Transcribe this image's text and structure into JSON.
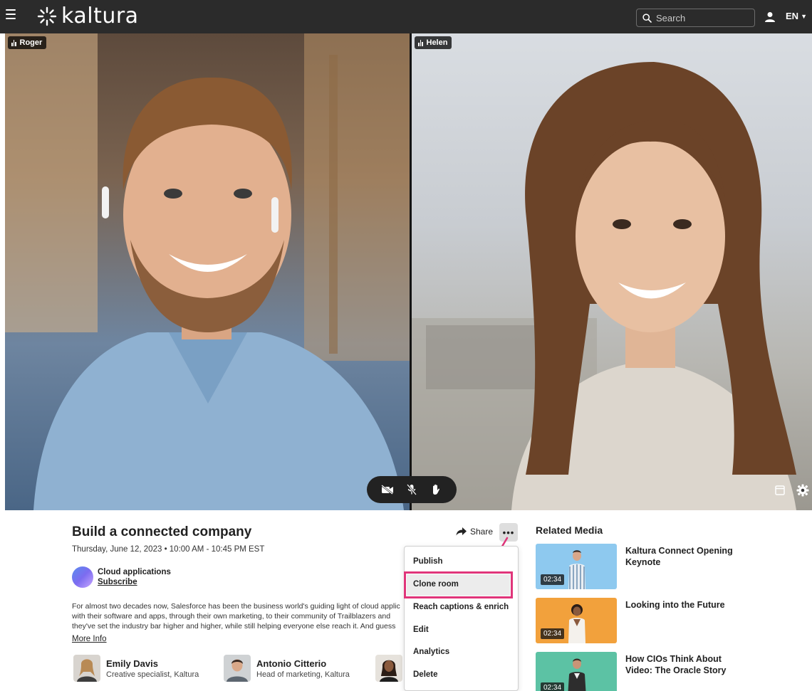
{
  "header": {
    "logo_text": "kaltura",
    "search_placeholder": "Search",
    "language": "EN"
  },
  "video": {
    "participants": [
      {
        "name": "Roger"
      },
      {
        "name": "Helen"
      }
    ],
    "controls": [
      "camera-off-icon",
      "mic-off-icon",
      "raise-hand-icon"
    ],
    "corner_controls": [
      "layout-icon",
      "settings-icon"
    ]
  },
  "details": {
    "title": "Build a connected company",
    "date": "Thursday, June 12, 2023  •  10:00 AM - 10:45 PM EST",
    "channel_name": "Cloud applications",
    "subscribe_label": "Subscribe",
    "description_lines": [
      "For almost two decades now, Salesforce has been the business world's guiding light of cloud applic",
      "with their software and apps, through their own marketing, to their community of Trailblazers and",
      "they've set the industry bar higher and higher, while still helping everyone else reach it. And guess"
    ],
    "more_info_label": "More Info",
    "speakers": [
      {
        "name": "Emily Davis",
        "role": "Creative specialist, Kaltura"
      },
      {
        "name": "Antonio Citterio",
        "role": "Head of marketing, Kaltura"
      }
    ]
  },
  "actions": {
    "share_label": "Share",
    "more_label": "•••"
  },
  "menu": {
    "items": [
      "Publish",
      "Clone room",
      "Reach captions & enrich",
      "Edit",
      "Analytics",
      "Delete"
    ],
    "highlighted": "Clone room",
    "highlight_color": "#e0357a"
  },
  "related": {
    "title": "Related Media",
    "items": [
      {
        "title": "Kaltura Connect Opening Keynote",
        "duration": "02:34",
        "thumb_color": "#8ec9ef"
      },
      {
        "title": "Looking into the Future",
        "duration": "02:34",
        "thumb_color": "#f2a13c"
      },
      {
        "title": "How CIOs Think About Video: The Oracle Story",
        "duration": "02:34",
        "thumb_color": "#5cc2a4"
      }
    ]
  }
}
